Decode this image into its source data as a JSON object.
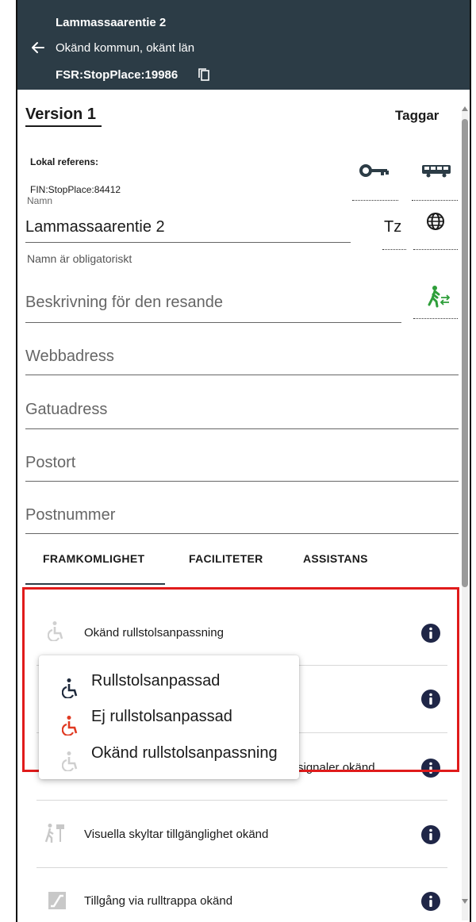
{
  "header": {
    "title": "Lammassaarentie 2",
    "municipality": "Okänd kommun, okänt län",
    "stop_place_id": "FSR:StopPlace:19986"
  },
  "version": {
    "label": "Version 1"
  },
  "tags": {
    "label": "Taggar"
  },
  "local_reference": {
    "label": "Lokal referens:",
    "value": "FIN:StopPlace:84412"
  },
  "name_field": {
    "label": "Namn",
    "value": "Lammassaarentie 2",
    "helper": "Namn är obligatoriskt",
    "tz_label": "Tz"
  },
  "fields": {
    "description_placeholder": "Beskrivning för den resande",
    "web_placeholder": "Webbadress",
    "street_placeholder": "Gatuadress",
    "city_placeholder": "Postort",
    "zip_placeholder": "Postnummer"
  },
  "tabs": [
    {
      "label": "FRAMKOMLIGHET",
      "active": true
    },
    {
      "label": "FACILITETER",
      "active": false
    },
    {
      "label": "ASSISTANS",
      "active": false
    }
  ],
  "accessibility": {
    "wheelchair_row": "Okänd rullstolsanpassning",
    "audio_row": "signaler okänd",
    "visual_row": "Visuella skyltar tillgänglighet okänd",
    "escalator_row": "Tillgång via rulltrappa okänd"
  },
  "wheelchair_menu": {
    "options": [
      {
        "label": "Rullstolsanpassad",
        "color": "#1f2a3c"
      },
      {
        "label": "Ej rullstolsanpassad",
        "color": "#e03a22"
      },
      {
        "label": "Okänd rullstolsanpassning",
        "color": "#cfcfcf"
      }
    ]
  },
  "colors": {
    "header_bg": "#2c3c46",
    "highlight": "#e01b1b",
    "accent_green": "#2e9e3a",
    "info_blue": "#1f2647"
  }
}
